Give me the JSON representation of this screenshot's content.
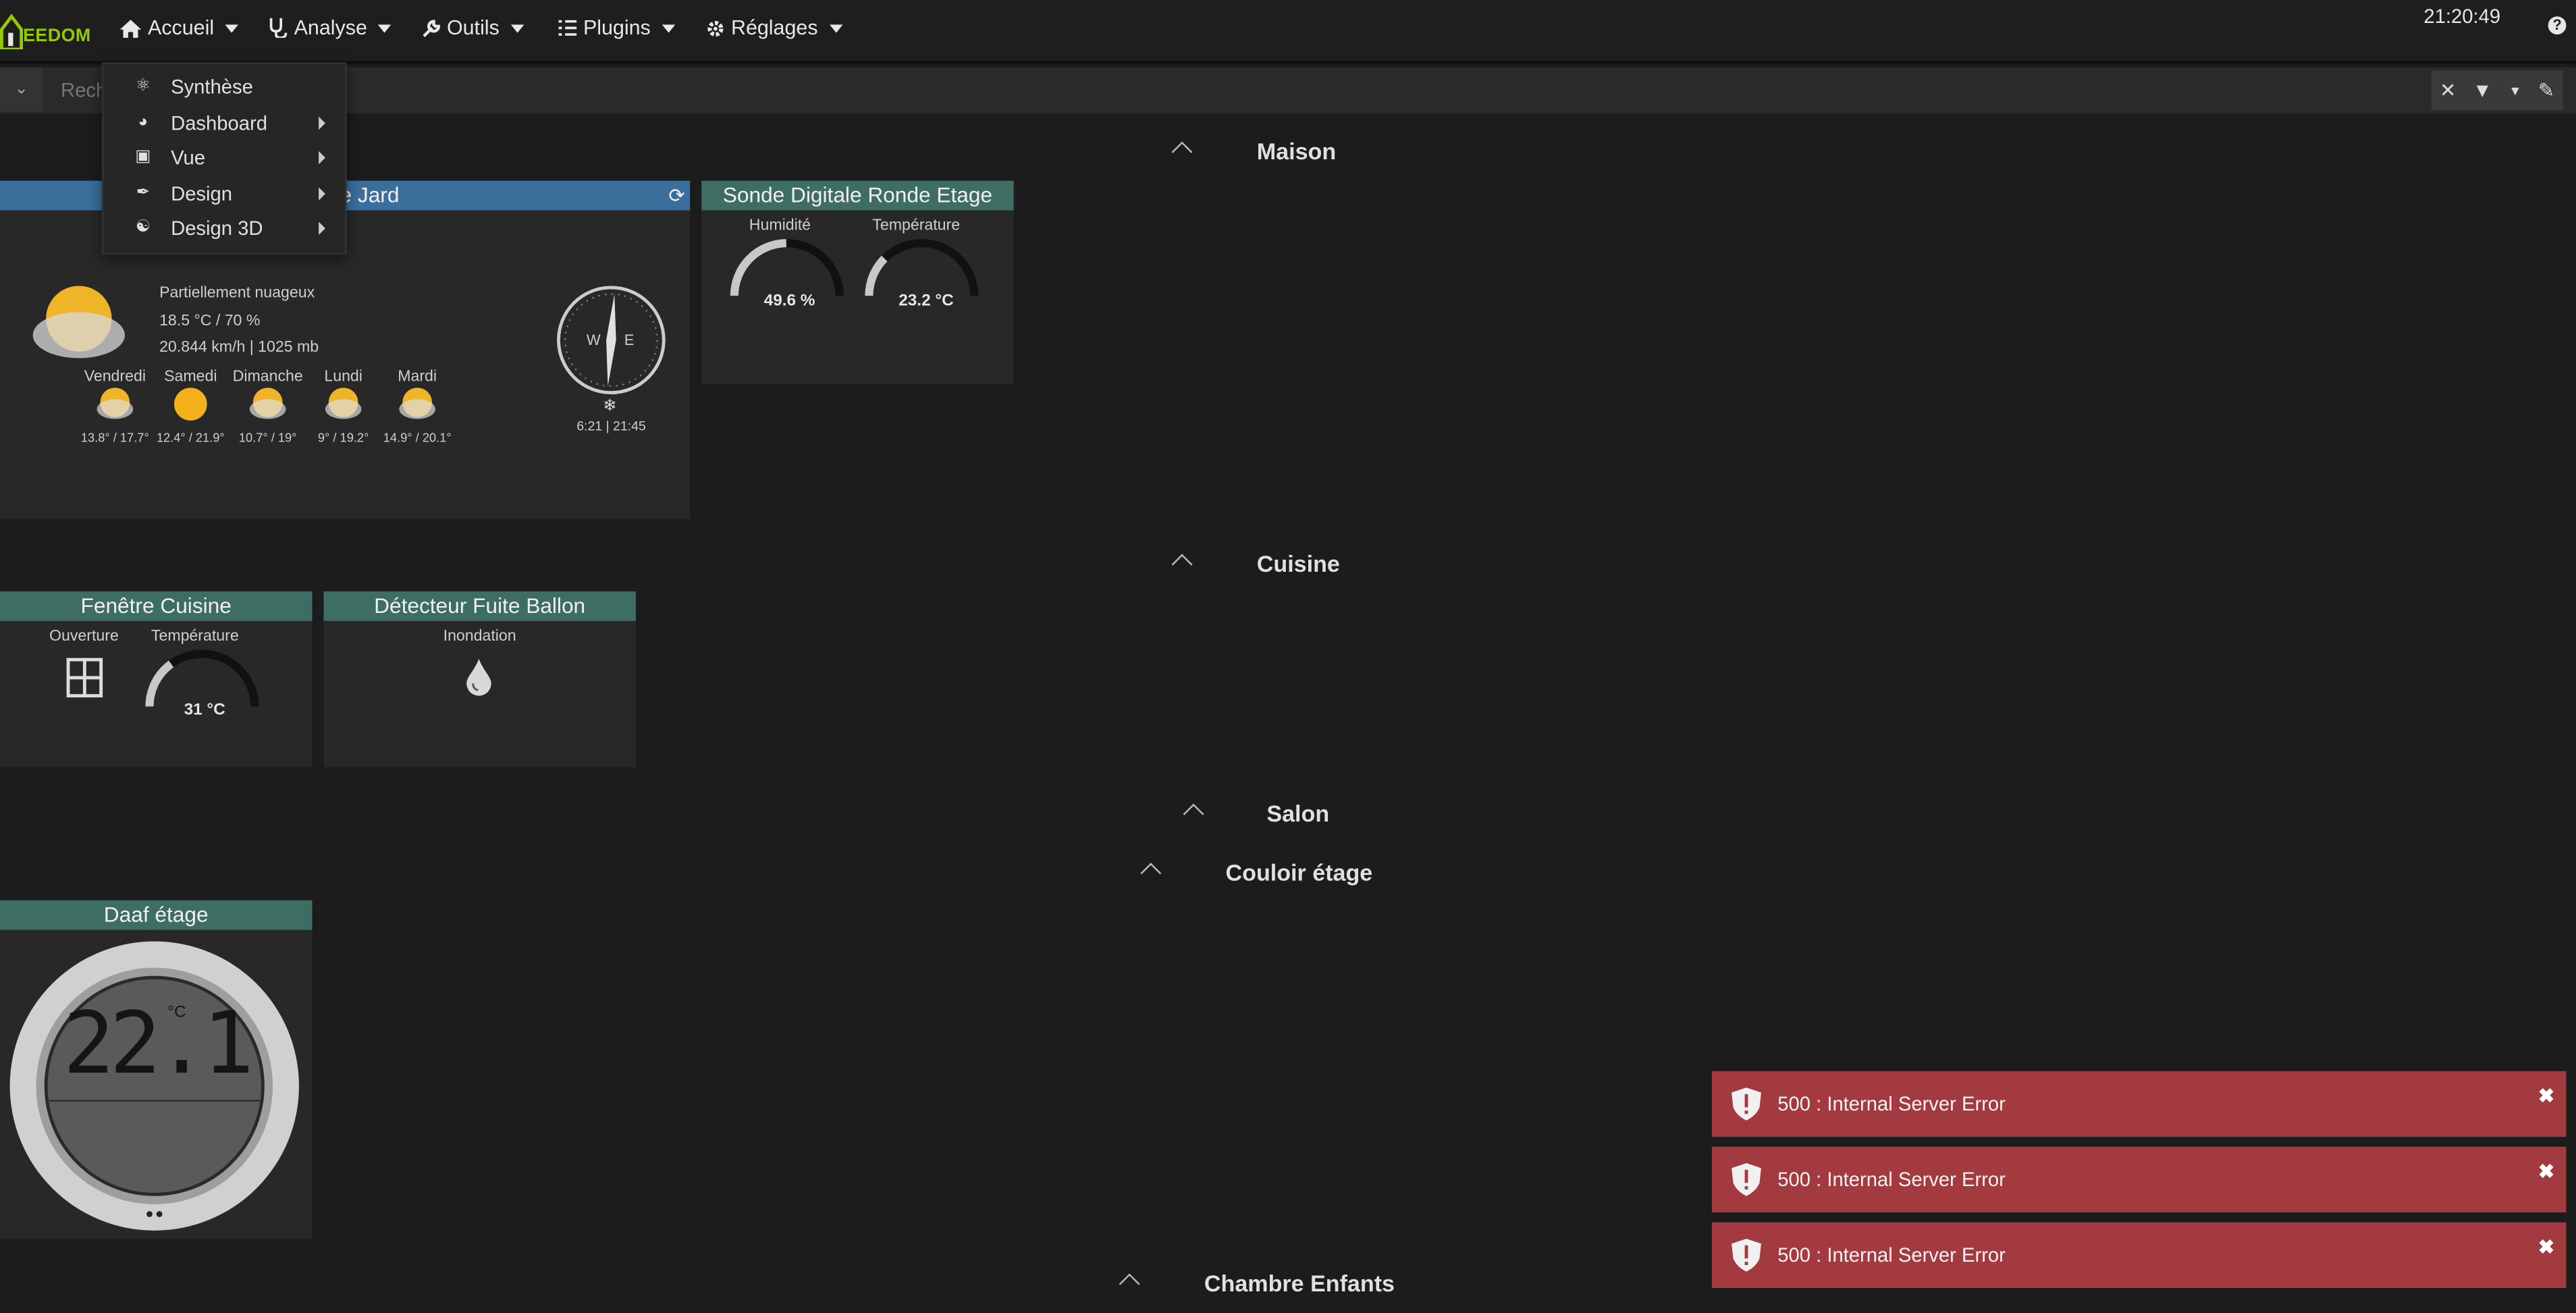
{
  "nav": {
    "logo_text": "EEDOM",
    "items": [
      {
        "label": "Accueil",
        "icon": "home-icon"
      },
      {
        "label": "Analyse",
        "icon": "stethoscope-icon"
      },
      {
        "label": "Outils",
        "icon": "wrench-icon"
      },
      {
        "label": "Plugins",
        "icon": "list-icon"
      },
      {
        "label": "Réglages",
        "icon": "gear-icon"
      }
    ],
    "clock": "21:20:49",
    "help": "?"
  },
  "search": {
    "placeholder": "Rech"
  },
  "dropdown": {
    "items": [
      {
        "label": "Synthèse",
        "icon": "hubspot-icon",
        "submenu": false
      },
      {
        "label": "Dashboard",
        "icon": "dashboard-icon",
        "submenu": true
      },
      {
        "label": "Vue",
        "icon": "image-icon",
        "submenu": true
      },
      {
        "label": "Design",
        "icon": "paintbrush-icon",
        "submenu": true
      },
      {
        "label": "Design 3D",
        "icon": "cubes-icon",
        "submenu": true
      }
    ]
  },
  "sections": {
    "maison": "Maison",
    "cuisine": "Cuisine",
    "salon": "Salon",
    "couloir": "Couloir étage",
    "chambre": "Chambre Enfants"
  },
  "weather": {
    "title_visible": "le Jard",
    "condition": "Partiellement nuageux",
    "temp_humidity": "18.5 °C / 70 %",
    "wind_pressure": "20.844 km/h | 1025 mb",
    "compass_w": "W",
    "compass_e": "E",
    "sun_times": "6:21 | 21:45",
    "forecast": [
      {
        "day": "Vendredi",
        "range": "13.8° / 17.7°",
        "icon": "partly-cloudy-icon"
      },
      {
        "day": "Samedi",
        "range": "12.4° / 21.9°",
        "icon": "sun-icon"
      },
      {
        "day": "Dimanche",
        "range": "10.7° / 19°",
        "icon": "partly-cloudy-icon"
      },
      {
        "day": "Lundi",
        "range": "9° / 19.2°",
        "icon": "partly-cloudy-icon"
      },
      {
        "day": "Mardi",
        "range": "14.9° / 20.1°",
        "icon": "partly-cloudy-icon"
      }
    ]
  },
  "sonde": {
    "title": "Sonde Digitale Ronde Etage",
    "humidity_label": "Humidité",
    "humidity_value": "49.6 %",
    "humidity_fraction": 0.496,
    "temp_label": "Température",
    "temp_value": "23.2 °C",
    "temp_fraction": 0.25
  },
  "fenetre": {
    "title": "Fenêtre Cuisine",
    "opening_label": "Ouverture",
    "temp_label": "Température",
    "temp_value": "31 °C",
    "temp_fraction": 0.3
  },
  "fuite": {
    "title": "Détecteur Fuite Ballon",
    "label": "Inondation"
  },
  "daaf": {
    "title": "Daaf étage",
    "value": "22.1",
    "unit": "°C"
  },
  "notifications": [
    {
      "message": "500 : Internal Server Error"
    },
    {
      "message": "500 : Internal Server Error"
    },
    {
      "message": "500 : Internal Server Error"
    }
  ],
  "colors": {
    "background": "#1c1c1c",
    "widget": "#282828",
    "header_blue": "#3a6f9c",
    "header_green": "#3e6e63",
    "error_red": "#a33a3f",
    "logo_green": "#93ca02"
  }
}
